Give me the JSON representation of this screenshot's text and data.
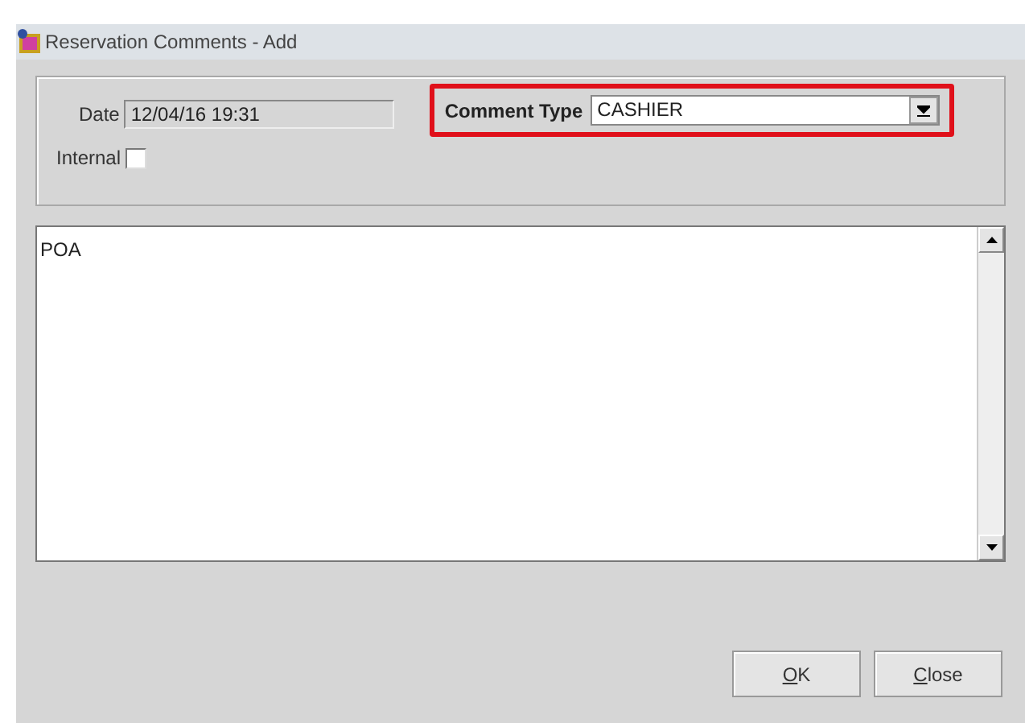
{
  "window": {
    "title": "Reservation Comments - Add"
  },
  "date": {
    "label": "Date",
    "value": "12/04/16 19:31"
  },
  "comment_type": {
    "label": "Comment Type",
    "value": "CASHIER",
    "highlighted": true
  },
  "internal": {
    "label": "Internal",
    "checked": false
  },
  "comment": {
    "value": "POA"
  },
  "buttons": [
    {
      "label": "OK"
    },
    {
      "label": "Close"
    }
  ]
}
